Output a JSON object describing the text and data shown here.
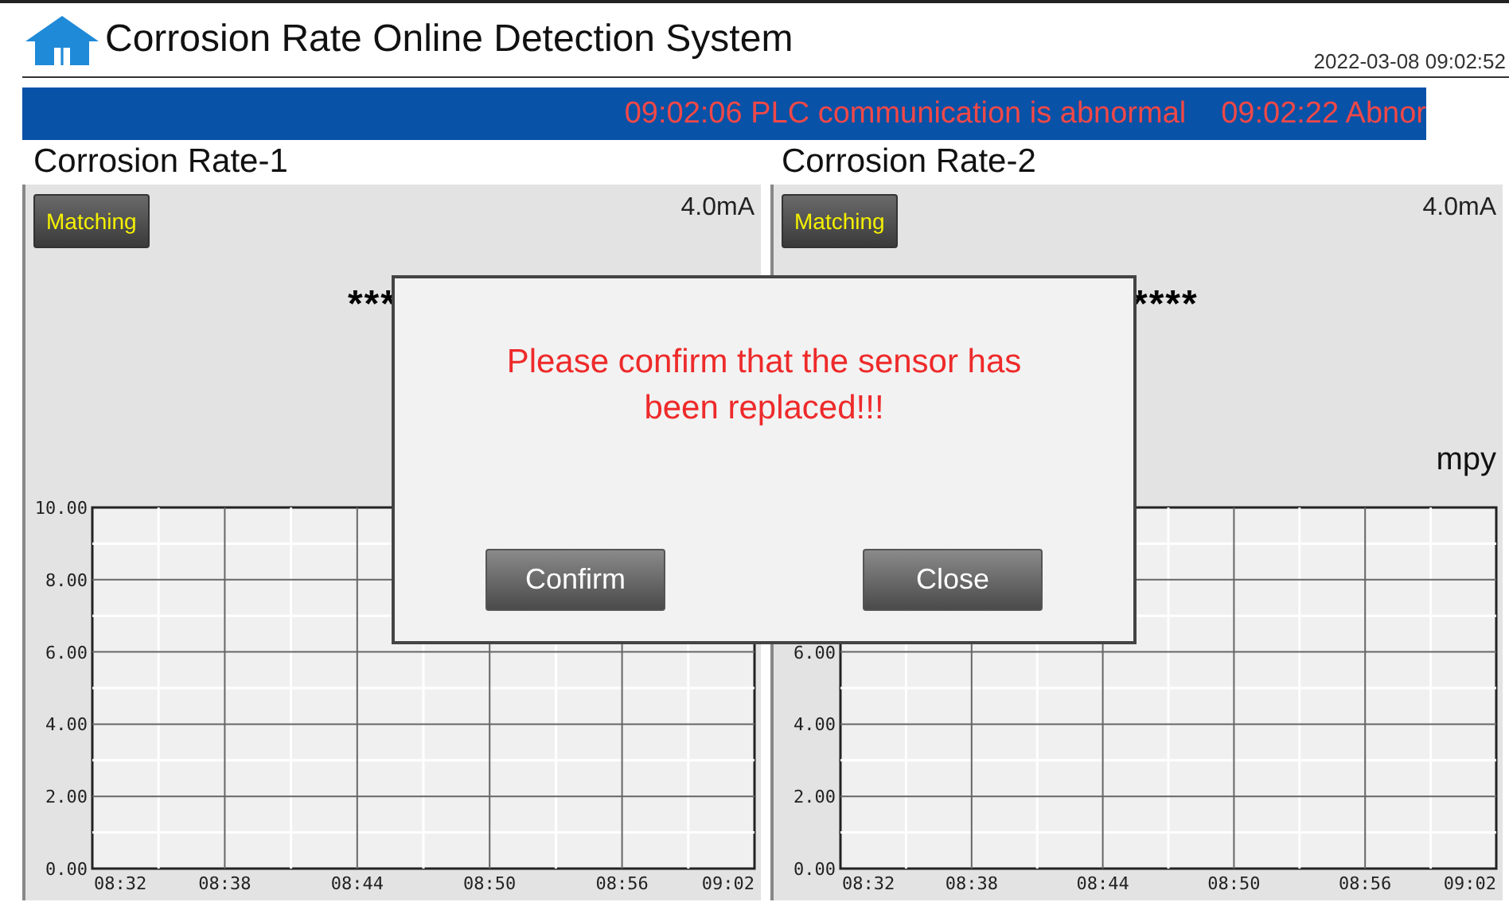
{
  "header": {
    "title": "Corrosion Rate Online Detection System",
    "datetime": "2022-03-08 09:02:52"
  },
  "alarm_banner": {
    "messages": [
      "09:02:06 PLC communication is abnormal",
      "09:02:22 Abnor"
    ]
  },
  "panels": [
    {
      "title": "Corrosion Rate-1",
      "button": "Matching",
      "current": "4.0mA",
      "value": "***",
      "chart_data": {
        "type": "line",
        "grid": true,
        "x": [
          "08:32",
          "08:38",
          "08:44",
          "08:50",
          "08:56",
          "09:02"
        ],
        "ylim": [
          0,
          10
        ],
        "yticks": [
          {
            "value": 0,
            "label": "0.00"
          },
          {
            "value": 2,
            "label": "2.00"
          },
          {
            "value": 4,
            "label": "4.00"
          },
          {
            "value": 6,
            "label": "6.00"
          },
          {
            "value": 8,
            "label": "8.00"
          },
          {
            "value": 10,
            "label": "10.00"
          }
        ]
      }
    },
    {
      "title": "Corrosion Rate-2",
      "button": "Matching",
      "current": "4.0mA",
      "value": "****",
      "unit": "mpy",
      "chart_data": {
        "type": "line",
        "grid": true,
        "x": [
          "08:32",
          "08:38",
          "08:44",
          "08:50",
          "08:56",
          "09:02"
        ],
        "ylim": [
          0,
          10
        ],
        "yticks": [
          {
            "value": 0,
            "label": "0.00"
          },
          {
            "value": 2,
            "label": "2.00"
          },
          {
            "value": 4,
            "label": "4.00"
          },
          {
            "value": 6,
            "label": "6.00"
          }
        ]
      }
    }
  ],
  "dialog": {
    "message": "Please confirm that the sensor has been replaced!!!",
    "buttons": [
      "Confirm",
      "Close"
    ]
  }
}
